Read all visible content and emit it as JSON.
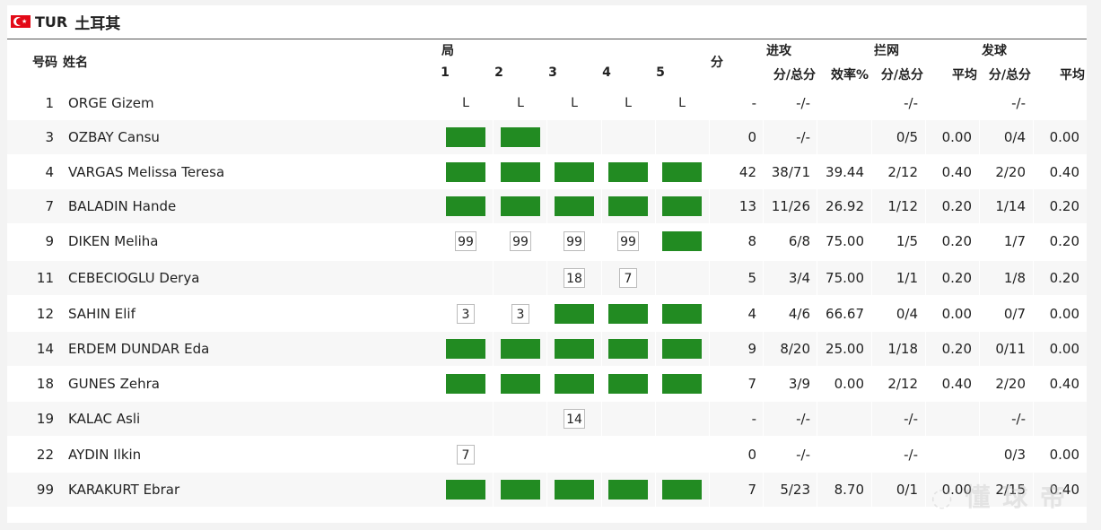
{
  "team": {
    "code": "TUR",
    "name": "土耳其",
    "flag_colors": {
      "red": "#e30a17",
      "white": "#ffffff"
    }
  },
  "headers": {
    "number": "号码",
    "name": "姓名",
    "sets": "局",
    "set_numbers": [
      "1",
      "2",
      "3",
      "4",
      "5"
    ],
    "points": "分",
    "attack": "进攻",
    "attack_score": "分/总分",
    "attack_eff": "效率%",
    "block": "拦网",
    "block_score": "分/总分",
    "block_avg": "平均",
    "serve": "发球",
    "serve_score": "分/总分",
    "serve_avg": "平均"
  },
  "colors": {
    "played_set": "#228b22"
  },
  "players": [
    {
      "no": "1",
      "name": "ORGE Gizem",
      "sets": [
        {
          "t": "L",
          "v": "L"
        },
        {
          "t": "L",
          "v": "L"
        },
        {
          "t": "L",
          "v": "L"
        },
        {
          "t": "L",
          "v": "L"
        },
        {
          "t": "L",
          "v": "L"
        }
      ],
      "points": "-",
      "attack": "-/-",
      "eff": "",
      "block": "-/-",
      "block_avg": "",
      "serve": "-/-",
      "serve_avg": ""
    },
    {
      "no": "3",
      "name": "OZBAY Cansu",
      "sets": [
        {
          "t": "G"
        },
        {
          "t": "G"
        },
        {
          "t": ""
        },
        {
          "t": ""
        },
        {
          "t": ""
        }
      ],
      "points": "0",
      "attack": "-/-",
      "eff": "",
      "block": "0/5",
      "block_avg": "0.00",
      "serve": "0/4",
      "serve_avg": "0.00"
    },
    {
      "no": "4",
      "name": "VARGAS Melissa Teresa",
      "sets": [
        {
          "t": "G"
        },
        {
          "t": "G"
        },
        {
          "t": "G"
        },
        {
          "t": "G"
        },
        {
          "t": "G"
        }
      ],
      "points": "42",
      "attack": "38/71",
      "eff": "39.44",
      "block": "2/12",
      "block_avg": "0.40",
      "serve": "2/20",
      "serve_avg": "0.40"
    },
    {
      "no": "7",
      "name": "BALADIN Hande",
      "sets": [
        {
          "t": "G"
        },
        {
          "t": "G"
        },
        {
          "t": "G"
        },
        {
          "t": "G"
        },
        {
          "t": "G"
        }
      ],
      "points": "13",
      "attack": "11/26",
      "eff": "26.92",
      "block": "1/12",
      "block_avg": "0.20",
      "serve": "1/14",
      "serve_avg": "0.20"
    },
    {
      "no": "9",
      "name": "DIKEN Meliha",
      "sets": [
        {
          "t": "N",
          "v": "99"
        },
        {
          "t": "N",
          "v": "99"
        },
        {
          "t": "N",
          "v": "99"
        },
        {
          "t": "N",
          "v": "99"
        },
        {
          "t": "G"
        }
      ],
      "points": "8",
      "attack": "6/8",
      "eff": "75.00",
      "block": "1/5",
      "block_avg": "0.20",
      "serve": "1/7",
      "serve_avg": "0.20"
    },
    {
      "no": "11",
      "name": "CEBECIOGLU Derya",
      "sets": [
        {
          "t": ""
        },
        {
          "t": ""
        },
        {
          "t": "N",
          "v": "18"
        },
        {
          "t": "N",
          "v": "7"
        },
        {
          "t": ""
        }
      ],
      "points": "5",
      "attack": "3/4",
      "eff": "75.00",
      "block": "1/1",
      "block_avg": "0.20",
      "serve": "1/8",
      "serve_avg": "0.20"
    },
    {
      "no": "12",
      "name": "SAHIN Elif",
      "sets": [
        {
          "t": "N",
          "v": "3"
        },
        {
          "t": "N",
          "v": "3"
        },
        {
          "t": "G"
        },
        {
          "t": "G"
        },
        {
          "t": "G"
        }
      ],
      "points": "4",
      "attack": "4/6",
      "eff": "66.67",
      "block": "0/4",
      "block_avg": "0.00",
      "serve": "0/7",
      "serve_avg": "0.00"
    },
    {
      "no": "14",
      "name": "ERDEM DUNDAR Eda",
      "sets": [
        {
          "t": "G"
        },
        {
          "t": "G"
        },
        {
          "t": "G"
        },
        {
          "t": "G"
        },
        {
          "t": "G"
        }
      ],
      "points": "9",
      "attack": "8/20",
      "eff": "25.00",
      "block": "1/18",
      "block_avg": "0.20",
      "serve": "0/11",
      "serve_avg": "0.00"
    },
    {
      "no": "18",
      "name": "GUNES Zehra",
      "sets": [
        {
          "t": "G"
        },
        {
          "t": "G"
        },
        {
          "t": "G"
        },
        {
          "t": "G"
        },
        {
          "t": "G"
        }
      ],
      "points": "7",
      "attack": "3/9",
      "eff": "0.00",
      "block": "2/12",
      "block_avg": "0.40",
      "serve": "2/20",
      "serve_avg": "0.40"
    },
    {
      "no": "19",
      "name": "KALAC Asli",
      "sets": [
        {
          "t": ""
        },
        {
          "t": ""
        },
        {
          "t": "N",
          "v": "14"
        },
        {
          "t": ""
        },
        {
          "t": ""
        }
      ],
      "points": "-",
      "attack": "-/-",
      "eff": "",
      "block": "-/-",
      "block_avg": "",
      "serve": "-/-",
      "serve_avg": ""
    },
    {
      "no": "22",
      "name": "AYDIN Ilkin",
      "sets": [
        {
          "t": "N",
          "v": "7"
        },
        {
          "t": ""
        },
        {
          "t": ""
        },
        {
          "t": ""
        },
        {
          "t": ""
        }
      ],
      "points": "0",
      "attack": "-/-",
      "eff": "",
      "block": "-/-",
      "block_avg": "",
      "serve": "0/3",
      "serve_avg": "0.00"
    },
    {
      "no": "99",
      "name": "KARAKURT Ebrar",
      "sets": [
        {
          "t": "G"
        },
        {
          "t": "G"
        },
        {
          "t": "G"
        },
        {
          "t": "G"
        },
        {
          "t": "G"
        }
      ],
      "points": "7",
      "attack": "5/23",
      "eff": "8.70",
      "block": "0/1",
      "block_avg": "0.00",
      "serve": "2/15",
      "serve_avg": "0.40"
    }
  ]
}
